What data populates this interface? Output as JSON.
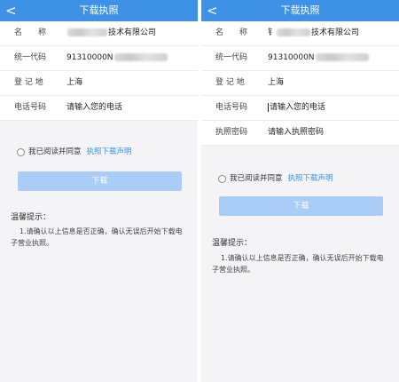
{
  "screens": [
    {
      "nav": {
        "back": "<",
        "title": "下载执照"
      },
      "fields": [
        {
          "label": "名　　称",
          "value": "技术有限公司",
          "type": "blurred-prefix"
        },
        {
          "label": "统一代码",
          "value": "91310000N",
          "type": "blurred-suffix"
        },
        {
          "label": "登 记 地",
          "value": "上海",
          "type": "plain"
        },
        {
          "label": "电话号码",
          "value": "请输入您的电话",
          "type": "placeholder"
        }
      ],
      "agree": {
        "text": "我已阅读并同意",
        "link": "执照下载声明"
      },
      "download_button": "下载",
      "tips": {
        "title": "温馨提示：",
        "body": "1.请确认以上信息是否正确，确认无误后开始下载电子营业执照。"
      }
    },
    {
      "nav": {
        "back": "<",
        "title": "下载执照"
      },
      "fields": [
        {
          "label": "名　　称",
          "value": "技术有限公司",
          "prefix_visible": "钅",
          "type": "blurred-prefix"
        },
        {
          "label": "统一代码",
          "value": "91310000N",
          "type": "blurred-suffix"
        },
        {
          "label": "登 记 地",
          "value": "上海",
          "type": "plain"
        },
        {
          "label": "电话号码",
          "value": "请输入您的电话",
          "type": "placeholder-focused"
        },
        {
          "label": "执照密码",
          "value": "请输入执照密码",
          "type": "placeholder"
        }
      ],
      "agree": {
        "text": "我已阅读并同意",
        "link": "执照下载声明"
      },
      "download_button": "下载",
      "tips": {
        "title": "温馨提示：",
        "body": "1.请确认以上信息是否正确，确认无误后开始下载电子营业执照。"
      }
    }
  ],
  "colors": {
    "nav": "#3e92e6",
    "link": "#3e92e6",
    "button_disabled": "#a9cdf6",
    "background": "#f4f4f6"
  }
}
